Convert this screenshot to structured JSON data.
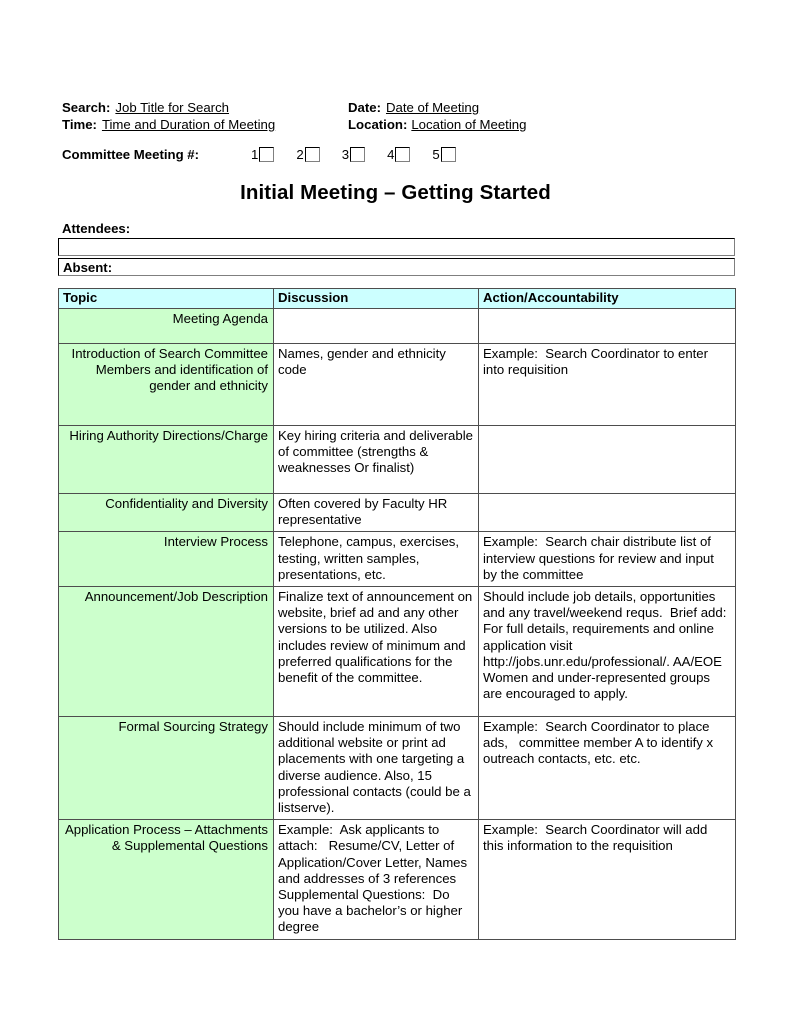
{
  "header": {
    "search_label": "Search:",
    "search_value": "Job Title for Search",
    "date_label": "Date:",
    "date_value": "Date of Meeting",
    "time_label": "Time:",
    "time_value": "Time and Duration of Meeting",
    "location_label": "Location:",
    "location_value": "Location of Meeting"
  },
  "committee": {
    "label": "Committee Meeting #:",
    "numbers": [
      "1",
      "2",
      "3",
      "4",
      "5"
    ]
  },
  "title": "Initial Meeting – Getting Started",
  "attendees": {
    "label": "Attendees:",
    "value": "",
    "absent_label": "Absent:",
    "absent_value": ""
  },
  "table": {
    "headers": [
      "Topic",
      "Discussion",
      "Action/Accountability"
    ],
    "rows": [
      {
        "topic": "Meeting Agenda",
        "discussion": "",
        "action": ""
      },
      {
        "topic": "Introduction of Search Committee Members and identification of gender and ethnicity",
        "discussion": "Names, gender and ethnicity code",
        "action": "Example:  Search Coordinator to enter into requisition"
      },
      {
        "topic": "Hiring Authority Directions/Charge",
        "discussion": "Key hiring criteria and deliverable of committee (strengths & weaknesses Or finalist)",
        "action": ""
      },
      {
        "topic": "Confidentiality and Diversity",
        "discussion": "Often covered by Faculty HR representative",
        "action": ""
      },
      {
        "topic": "Interview Process",
        "discussion": "Telephone, campus, exercises, testing, written samples, presentations, etc.",
        "action": "Example:  Search chair distribute list of interview questions for review and input by the committee"
      },
      {
        "topic": "Announcement/Job Description",
        "discussion": "Finalize text of announcement on website, brief ad and any other versions to be utilized. Also includes review of minimum and preferred qualifications for the benefit of the committee.",
        "action": "Should include job details, opportunities and any travel/weekend requs.  Brief add:  For full details, requirements and online application visit http://jobs.unr.edu/professional/. AA/EOE Women and under-represented groups are encouraged to apply."
      },
      {
        "topic": "Formal Sourcing Strategy",
        "discussion": "Should include minimum of two additional website or print ad placements with one targeting a diverse audience. Also, 15 professional contacts (could be a listserve).",
        "action": "Example:  Search Coordinator to place ads,   committee member A to identify x outreach contacts, etc. etc."
      },
      {
        "topic": "Application Process – Attachments & Supplemental Questions",
        "discussion": "Example:  Ask applicants to attach:   Resume/CV, Letter of Application/Cover Letter, Names and addresses of 3 references     Supplemental Questions:  Do you have a bachelor’s or higher degree",
        "action": "Example:  Search Coordinator will add this information to the requisition"
      }
    ]
  },
  "colors": {
    "header_fill": "#ccffff",
    "topic_fill": "#ccffcc",
    "border": "#4d4d4d"
  }
}
